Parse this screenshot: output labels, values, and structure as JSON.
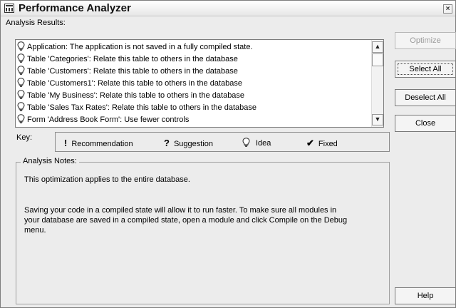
{
  "window": {
    "title": "Performance Analyzer"
  },
  "results": {
    "label": "Analysis Results:",
    "items": [
      "Application: The application is not saved in a fully compiled state.",
      "Table 'Categories': Relate this table to others in the database",
      "Table 'Customers': Relate this table to others in the database",
      "Table 'Customers1': Relate this table to others in the database",
      "Table 'My Business': Relate this table to others in the database",
      "Table 'Sales Tax Rates': Relate this table to others in the database",
      "Form 'Address Book Form': Use fewer controls"
    ],
    "item_icon": "idea-lightbulb-icon"
  },
  "key": {
    "label": "Key:",
    "items": [
      {
        "symbol": "!",
        "label": "Recommendation",
        "icon": "recommendation-icon"
      },
      {
        "symbol": "?",
        "label": "Suggestion",
        "icon": "suggestion-icon"
      },
      {
        "symbol": "",
        "label": "Idea",
        "icon": "idea-lightbulb-icon"
      },
      {
        "symbol": "✔",
        "label": "Fixed",
        "icon": "fixed-checkmark-icon"
      }
    ]
  },
  "notes": {
    "legend": "Analysis Notes:",
    "line1": "This optimization applies to the entire database.",
    "line2": "Saving your code in a compiled state will allow it to run faster. To make sure all modules in",
    "line3": "your database are saved in a compiled state, open a module and click Compile on the Debug",
    "line4": "menu."
  },
  "buttons": {
    "optimize": "Optimize",
    "select_all": "Select All",
    "deselect_all": "Deselect All",
    "close": "Close",
    "help": "Help"
  }
}
